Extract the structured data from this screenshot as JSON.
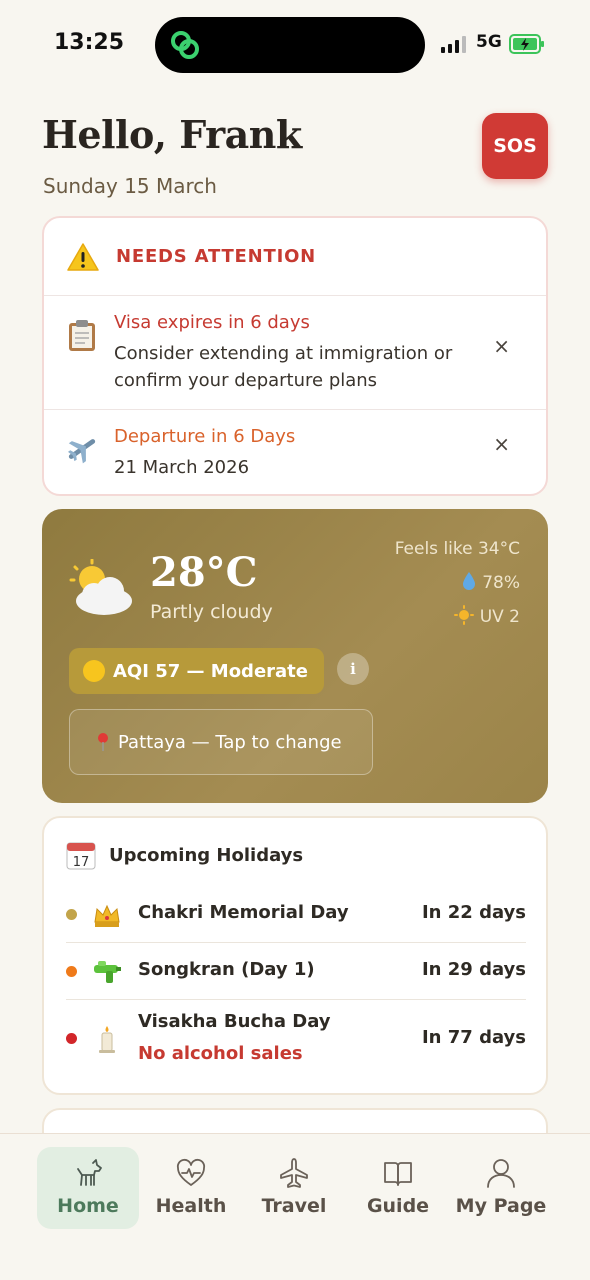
{
  "status_bar": {
    "time": "13:25",
    "network": "5G"
  },
  "header": {
    "greeting": "Hello, Frank",
    "date": "Sunday 15 March",
    "sos_label": "SOS"
  },
  "attention": {
    "title": "NEEDS ATTENTION",
    "items": [
      {
        "icon": "clipboard-icon",
        "title": "Visa expires in 6 days",
        "subtitle": "Consider extending at immigration or confirm your departure plans",
        "close": "×"
      },
      {
        "icon": "airplane-icon",
        "title": "Departure in 6 Days",
        "subtitle": "21 March 2026",
        "close": "×"
      }
    ]
  },
  "weather": {
    "temperature": "28°C",
    "condition": "Partly cloudy",
    "feels_like": "Feels like 34°C",
    "humidity": "78%",
    "uv": "UV 2",
    "aqi": "AQI 57 — Moderate",
    "info": "i",
    "location": "Pattaya — Tap to change",
    "colors": {
      "card": "#9c854a",
      "aqi_badge": "#b79a3a",
      "aqi_dot": "#f7c51e"
    }
  },
  "holidays": {
    "title": "Upcoming Holidays",
    "items": [
      {
        "dot_color": "#c2a44a",
        "icon": "crown-icon",
        "name": "Chakri Memorial Day",
        "days": "In 22 days",
        "note": ""
      },
      {
        "dot_color": "#ef7a1a",
        "icon": "water-gun-icon",
        "name": "Songkran (Day 1)",
        "days": "In 29 days",
        "note": ""
      },
      {
        "dot_color": "#d2262a",
        "icon": "candle-icon",
        "name": "Visakha Bucha Day",
        "days": "In 77 days",
        "note": "No alcohol sales"
      }
    ]
  },
  "tabbar": {
    "tabs": [
      {
        "label": "Home",
        "icon": "dog-icon",
        "active": true
      },
      {
        "label": "Health",
        "icon": "heart-pulse-icon",
        "active": false
      },
      {
        "label": "Travel",
        "icon": "airplane-icon",
        "active": false
      },
      {
        "label": "Guide",
        "icon": "book-icon",
        "active": false
      },
      {
        "label": "My Page",
        "icon": "person-icon",
        "active": false
      }
    ]
  },
  "colors": {
    "background": "#f8f6f0",
    "accent_red": "#c63a31",
    "accent_orange": "#d9622b",
    "active_tab": "#4d7a5c"
  }
}
